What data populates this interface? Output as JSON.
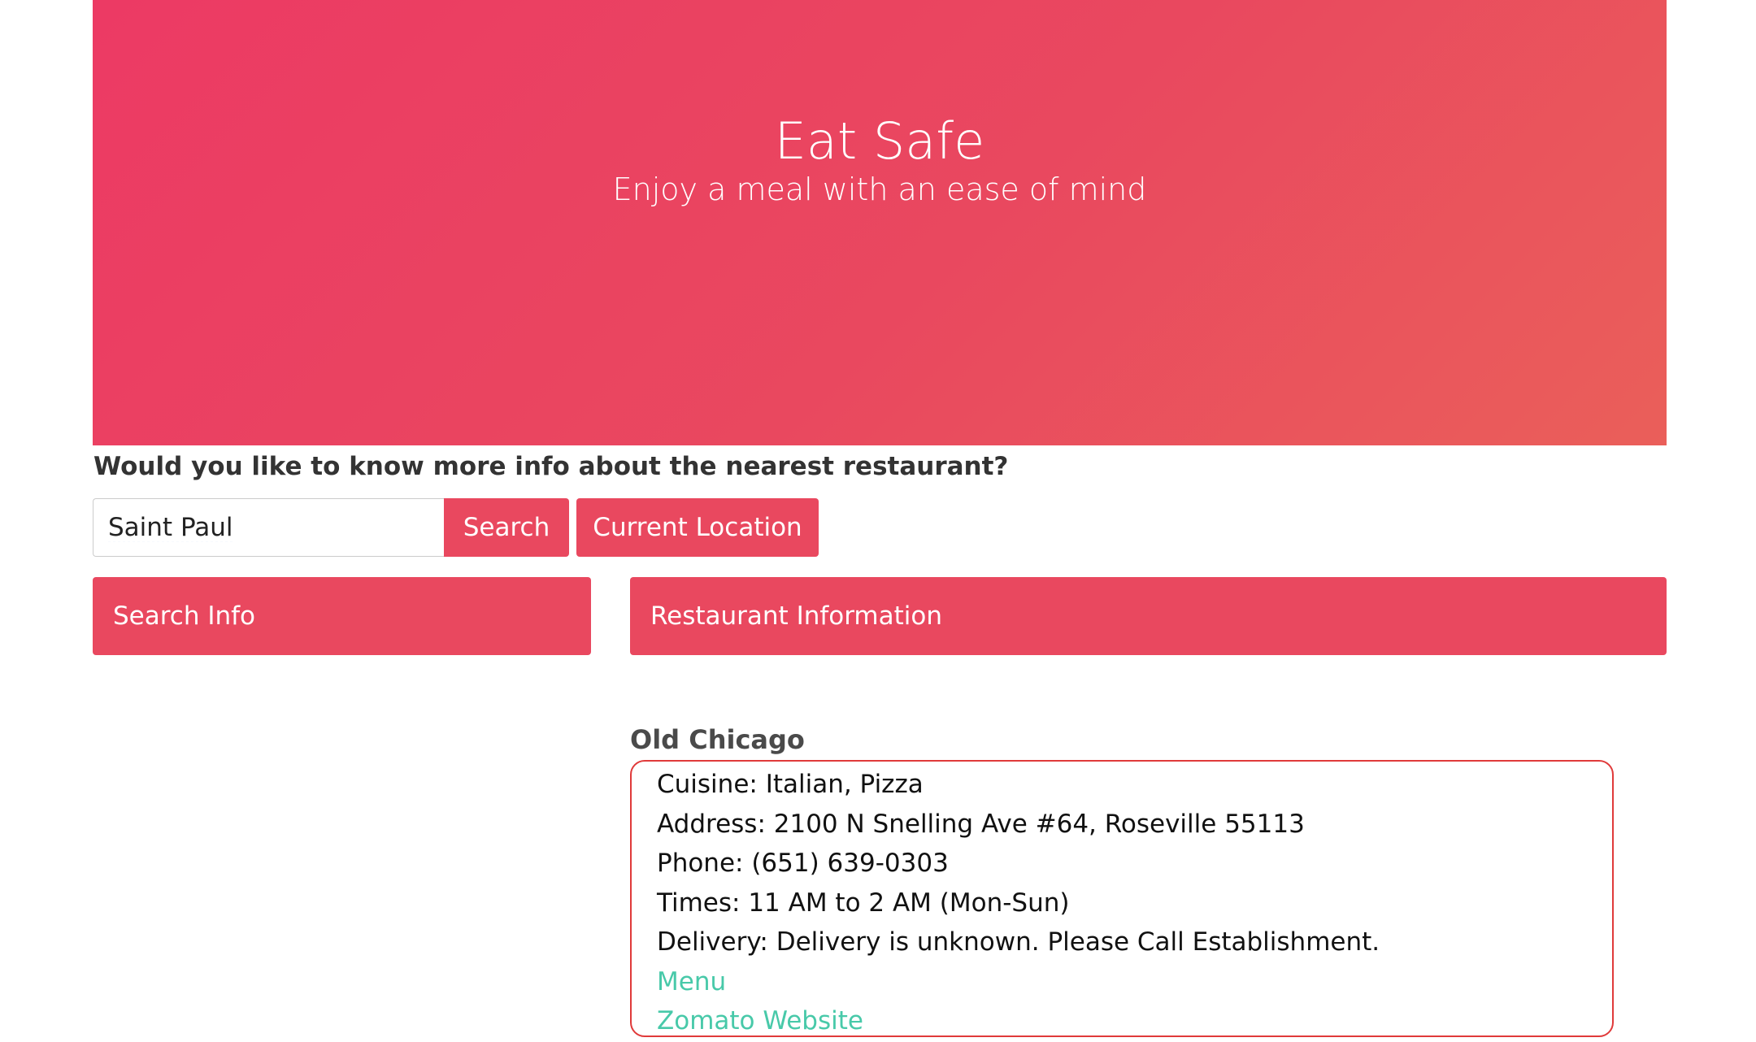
{
  "hero": {
    "title": "Eat Safe",
    "subtitle": "Enjoy a meal with an ease of mind"
  },
  "search": {
    "question": "Would you like to know more info about the nearest restaurant?",
    "input_value": "Saint Paul",
    "search_label": "Search",
    "location_label": "Current Location"
  },
  "panels": {
    "search_info": "Search Info",
    "restaurant_info": "Restaurant Information"
  },
  "restaurant": {
    "name": "Old Chicago",
    "cuisine": "Cuisine: Italian, Pizza",
    "address": "Address: 2100 N Snelling Ave #64, Roseville 55113",
    "phone": "Phone: (651) 639-0303",
    "times": "Times: 11 AM to 2 AM (Mon-Sun)",
    "delivery": "Delivery: Delivery is unknown. Please Call Establishment.",
    "menu_link": "Menu",
    "website_link": "Zomato Website"
  },
  "colors": {
    "accent": "#e9485f",
    "link": "#48c9a9",
    "box_border": "#e03a3a"
  }
}
